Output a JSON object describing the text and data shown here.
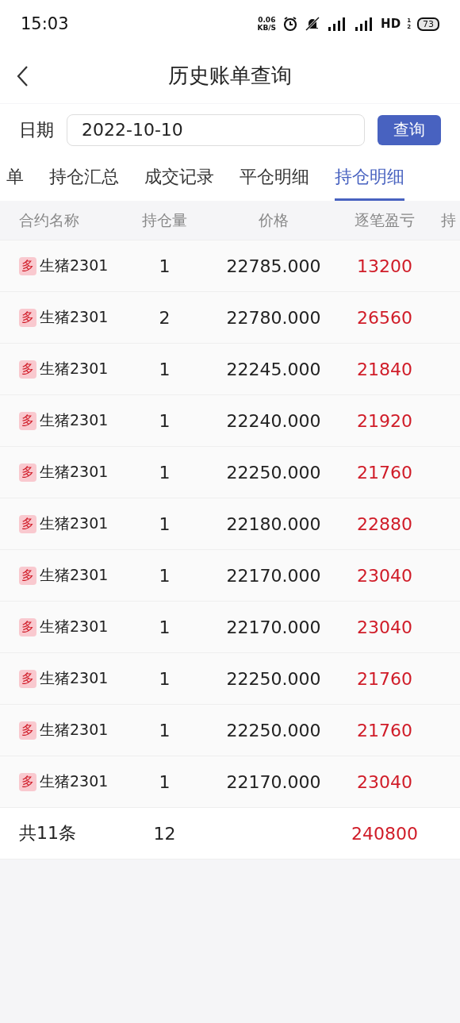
{
  "status_bar": {
    "time": "15:03",
    "net_speed": [
      "0.06",
      "KB/S"
    ],
    "hd": "HD",
    "hd_slots": [
      "1",
      "2"
    ],
    "battery": "73"
  },
  "header": {
    "title": "历史账单查询"
  },
  "query": {
    "label": "日期",
    "value": "2022-10-10",
    "button": "查询"
  },
  "tabs": [
    {
      "label": "单",
      "selected": false
    },
    {
      "label": "持仓汇总",
      "selected": false
    },
    {
      "label": "成交记录",
      "selected": false
    },
    {
      "label": "平仓明细",
      "selected": false
    },
    {
      "label": "持仓明细",
      "selected": true
    }
  ],
  "table": {
    "columns": [
      "合约名称",
      "持仓量",
      "价格",
      "逐笔盈亏",
      "持"
    ],
    "rows": [
      {
        "direction": "多",
        "name": "生猪2301",
        "qty": "1",
        "price": "22785.000",
        "pnl": "13200"
      },
      {
        "direction": "多",
        "name": "生猪2301",
        "qty": "2",
        "price": "22780.000",
        "pnl": "26560"
      },
      {
        "direction": "多",
        "name": "生猪2301",
        "qty": "1",
        "price": "22245.000",
        "pnl": "21840"
      },
      {
        "direction": "多",
        "name": "生猪2301",
        "qty": "1",
        "price": "22240.000",
        "pnl": "21920"
      },
      {
        "direction": "多",
        "name": "生猪2301",
        "qty": "1",
        "price": "22250.000",
        "pnl": "21760"
      },
      {
        "direction": "多",
        "name": "生猪2301",
        "qty": "1",
        "price": "22180.000",
        "pnl": "22880"
      },
      {
        "direction": "多",
        "name": "生猪2301",
        "qty": "1",
        "price": "22170.000",
        "pnl": "23040"
      },
      {
        "direction": "多",
        "name": "生猪2301",
        "qty": "1",
        "price": "22170.000",
        "pnl": "23040"
      },
      {
        "direction": "多",
        "name": "生猪2301",
        "qty": "1",
        "price": "22250.000",
        "pnl": "21760"
      },
      {
        "direction": "多",
        "name": "生猪2301",
        "qty": "1",
        "price": "22250.000",
        "pnl": "21760"
      },
      {
        "direction": "多",
        "name": "生猪2301",
        "qty": "1",
        "price": "22170.000",
        "pnl": "23040"
      }
    ],
    "footer": {
      "count": "共11条",
      "qty": "12",
      "pnl": "240800"
    }
  }
}
